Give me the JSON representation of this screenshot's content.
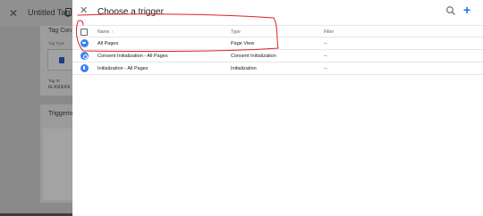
{
  "background": {
    "close_icon": "close-icon",
    "title": "Untitled Tag",
    "card1_title": "Tag Con",
    "tag_type_label": "Tag Type",
    "tag_id_label": "Tag ID",
    "tag_id_value": "G-XXXXX",
    "card2_title": "Triggerin"
  },
  "panel": {
    "title": "Choose a trigger",
    "close_icon": "close-icon",
    "search_icon": "search-icon",
    "add_icon": "add-icon",
    "accent": "#1a73e8"
  },
  "table": {
    "headers": {
      "name": "Name",
      "sort": "↑",
      "type": "Type",
      "filter": "Filter"
    },
    "rows": [
      {
        "name": "All Pages",
        "type": "Page View",
        "filter": "--",
        "icon": "pageview-icon"
      },
      {
        "name": "Consent Initialization - All Pages",
        "type": "Consent Initialization",
        "filter": "--",
        "icon": "consent-icon"
      },
      {
        "name": "Initialization - All Pages",
        "type": "Initialization",
        "filter": "--",
        "icon": "initialization-icon"
      }
    ]
  },
  "annotation": {
    "color": "#e02020"
  }
}
